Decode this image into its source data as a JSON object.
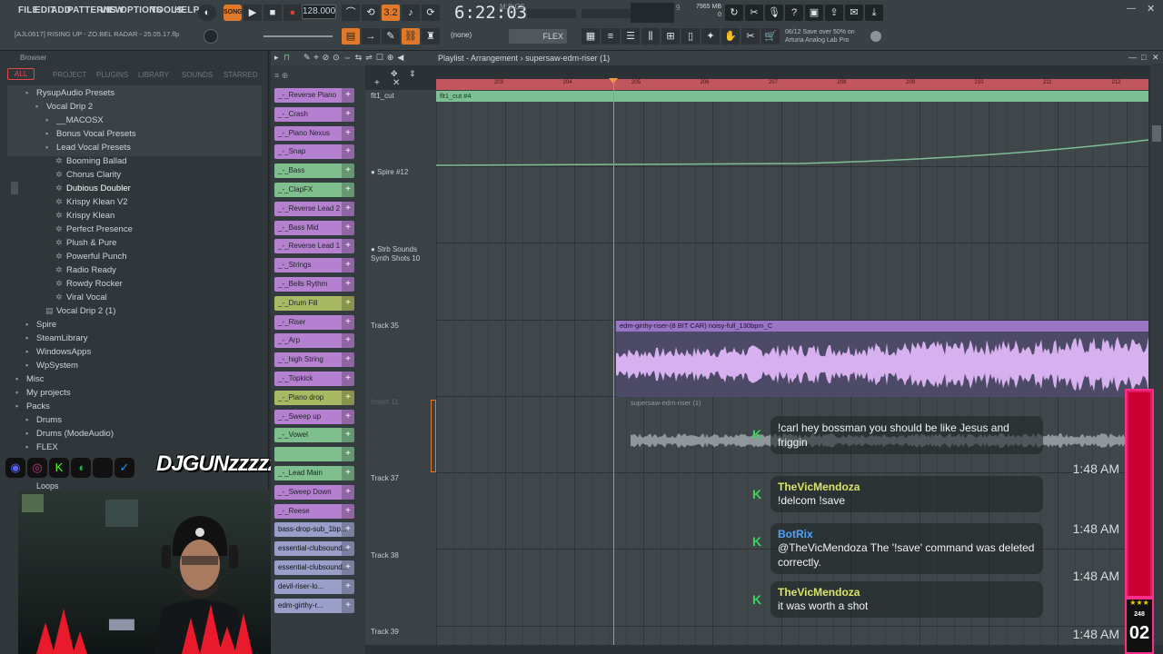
{
  "menu": {
    "items": [
      "FILE",
      "EDIT",
      "ADD",
      "PATTERNS",
      "VIEW",
      "OPTIONS",
      "TOOLS",
      "HELP"
    ]
  },
  "transport": {
    "mode": "SONG",
    "tempo": "128.000",
    "time": "6:22:03",
    "time_unit": "M:S:CS",
    "cpu_label": "9",
    "mem_label": "7965 MB",
    "mem_sub": "0"
  },
  "hint_bar": {
    "text": "[AJL0617] RISING UP - ZO.BEL RADAR - 25.05.17.flp"
  },
  "snap": {
    "value": "(none)",
    "tool": "FLEX"
  },
  "promo": {
    "date": "06/12",
    "line1": "Save over 50% on",
    "line2": "Arturia Analog Lab Pro"
  },
  "browser": {
    "title": "Browser",
    "tabs": [
      "ALL",
      "PROJECT",
      "PLUGINS",
      "LIBRARY",
      "SOUNDS",
      "STARRED"
    ],
    "tree": [
      {
        "label": "RysupAudio Presets",
        "level": 0,
        "icon": "folder"
      },
      {
        "label": "Vocal Drip 2",
        "level": 1,
        "icon": "folder"
      },
      {
        "label": "__MACOSX",
        "level": 2,
        "icon": "folder"
      },
      {
        "label": "Bonus Vocal Presets",
        "level": 2,
        "icon": "folder"
      },
      {
        "label": "Lead Vocal Presets",
        "level": 2,
        "icon": "folder"
      },
      {
        "label": "Booming Ballad",
        "level": 3,
        "icon": "preset"
      },
      {
        "label": "Chorus Clarity",
        "level": 3,
        "icon": "preset"
      },
      {
        "label": "Dubious Doubler",
        "level": 3,
        "icon": "preset",
        "highlight": true
      },
      {
        "label": "Krispy Klean V2",
        "level": 3,
        "icon": "preset"
      },
      {
        "label": "Krispy Klean",
        "level": 3,
        "icon": "preset"
      },
      {
        "label": "Perfect Presence",
        "level": 3,
        "icon": "preset"
      },
      {
        "label": "Plush & Pure",
        "level": 3,
        "icon": "preset"
      },
      {
        "label": "Powerful Punch",
        "level": 3,
        "icon": "preset"
      },
      {
        "label": "Radio Ready",
        "level": 3,
        "icon": "preset"
      },
      {
        "label": "Rowdy Rocker",
        "level": 3,
        "icon": "preset"
      },
      {
        "label": "Viral Vocal",
        "level": 3,
        "icon": "preset"
      },
      {
        "label": "Vocal Drip 2 (1)",
        "level": 2,
        "icon": "file"
      },
      {
        "label": "Spire",
        "level": 0,
        "icon": "folder"
      },
      {
        "label": "SteamLibrary",
        "level": 0,
        "icon": "folder"
      },
      {
        "label": "WindowsApps",
        "level": 0,
        "icon": "folder"
      },
      {
        "label": "WpSystem",
        "level": 0,
        "icon": "folder"
      },
      {
        "label": "Misc",
        "level": -1,
        "icon": "folder"
      },
      {
        "label": "My projects",
        "level": -1,
        "icon": "folder"
      },
      {
        "label": "Packs",
        "level": -1,
        "icon": "folder"
      },
      {
        "label": "Drums",
        "level": 0,
        "icon": "folder"
      },
      {
        "label": "Drums (ModeAudio)",
        "level": 0,
        "icon": "folder"
      },
      {
        "label": "FLEX",
        "level": 0,
        "icon": "folder"
      }
    ]
  },
  "overlay": {
    "name": "DJGUNzzzzzzz",
    "social_icons": [
      "discord-icon",
      "instagram-icon",
      "kick-icon",
      "spotify-icon",
      "tiktok-icon",
      "twitter-icon"
    ],
    "browser_peek": [
      "Loops"
    ],
    "logo_glyph": "S"
  },
  "channels": [
    {
      "name": "_-_Reverse Piano",
      "color": "purple"
    },
    {
      "name": "_-_Crash",
      "color": "purple"
    },
    {
      "name": "_-_Piano Nexus",
      "color": "purple"
    },
    {
      "name": "_-_Snap",
      "color": "purple"
    },
    {
      "name": "_-_Bass",
      "color": "green"
    },
    {
      "name": "_-_ClapFX",
      "color": "green"
    },
    {
      "name": "_-_Reverse Lead 2",
      "color": "purple"
    },
    {
      "name": "_-_Bass Mid",
      "color": "purple"
    },
    {
      "name": "_-_Reverse Lead 1",
      "color": "purple"
    },
    {
      "name": "_-_Strings",
      "color": "purple"
    },
    {
      "name": "_-_Bells Rythm",
      "color": "purple"
    },
    {
      "name": "_-_Drum Fill",
      "color": "olive"
    },
    {
      "name": "_-_Riser",
      "color": "purple"
    },
    {
      "name": "_-_Arp",
      "color": "purple"
    },
    {
      "name": "_-_high String",
      "color": "purple"
    },
    {
      "name": "_-_Topkick",
      "color": "purple"
    },
    {
      "name": "_-_Piano drop",
      "color": "olive"
    },
    {
      "name": "_-_Sweep up",
      "color": "purple"
    },
    {
      "name": "_-_Vowel",
      "color": "green"
    },
    {
      "name": "",
      "color": "green"
    },
    {
      "name": "_-_Lead Main",
      "color": "green"
    },
    {
      "name": "_-_Sweep Down",
      "color": "purple"
    },
    {
      "name": "_-_Reese",
      "color": "purple"
    },
    {
      "name": "bass-drop-sub_1bp...",
      "color": "sample"
    },
    {
      "name": "essential-clubsound...",
      "color": "sample"
    },
    {
      "name": "essential-clubsound...",
      "color": "sample"
    },
    {
      "name": "devil-riser-lo...",
      "color": "sample"
    },
    {
      "name": "edm-girthy-r...",
      "color": "sample"
    }
  ],
  "playlist": {
    "title": "Playlist - Arrangement",
    "pattern": "supersaw-edm-riser (1)",
    "ruler_bars": [
      "203",
      "204",
      "205",
      "206",
      "207",
      "208",
      "209",
      "210",
      "211",
      "212"
    ],
    "tracks": [
      {
        "label": "flt1_cut"
      },
      {
        "label": "Spire #12"
      },
      {
        "label": "Strb Sounds"
      },
      {
        "label": "Synth Shots 10"
      },
      {
        "label": "Track 35"
      },
      {
        "label": "Insert 11"
      },
      {
        "label": "Track 37"
      },
      {
        "label": "Track 38"
      },
      {
        "label": "Track 39"
      }
    ],
    "clips": {
      "automation": "flt1_cut #4",
      "audio": "edm-girthy-riser-(8 BIT CAR) noisy-full_130bpm_C",
      "audio2": "supersaw-edm-riser (1)"
    }
  },
  "chat": {
    "messages": [
      {
        "user": "",
        "text": "!carl hey bossman you should be like Jesus and friggin",
        "time": "1:48 AM",
        "bot": false
      },
      {
        "user": "TheVicMendoza",
        "text": "!delcom !save",
        "time": "1:48 AM",
        "bot": false
      },
      {
        "user": "BotRix",
        "text": "@TheVicMendoza The '!save' command was deleted correctly.",
        "time": "1:48 AM",
        "bot": true
      },
      {
        "user": "TheVicMendoza",
        "text": "it was worth a shot",
        "time": "1:48 AM",
        "bot": false
      }
    ]
  },
  "stream_badge": {
    "stars": "★★★",
    "count": "248",
    "number": "02"
  },
  "colors": {
    "accent_orange": "#e1792a",
    "ruler_red": "#c2565e",
    "clip_green": "#7dbf95",
    "clip_purple": "#9a74c5",
    "chat_green": "#3fd35a",
    "bot_blue": "#4ea4ff",
    "meter_pink": "#ff2d8a"
  }
}
